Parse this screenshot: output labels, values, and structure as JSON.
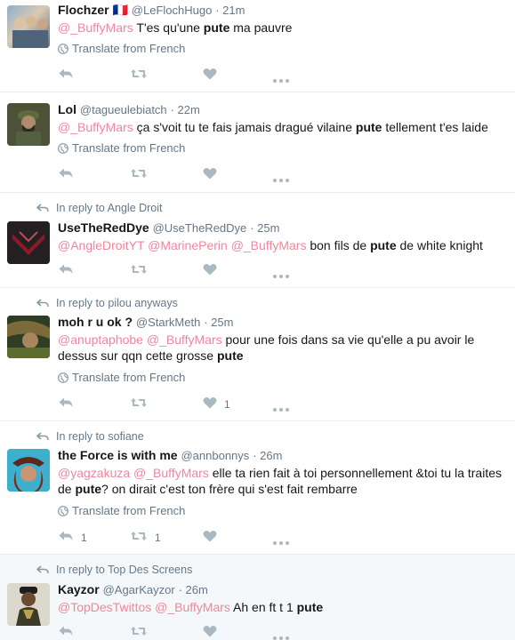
{
  "ui": {
    "translate_label": "Translate from French"
  },
  "tweets": [
    {
      "name": "Flochzer",
      "flag": "🇫🇷",
      "handle": "@LeFlochHugo",
      "time": "· 21m",
      "text": [
        {
          "t": "@_BuffyMars",
          "s": "mention"
        },
        {
          "t": " T'es qu'une ",
          "s": "plain"
        },
        {
          "t": "pute",
          "s": "kw"
        },
        {
          "t": " ma pauvre",
          "s": "plain"
        }
      ],
      "translate": true,
      "reply_count": "",
      "retweet_count": "",
      "like_count": ""
    },
    {
      "name": "Lol",
      "handle": "@tagueulebiatch",
      "time": "· 22m",
      "text": [
        {
          "t": "@_BuffyMars",
          "s": "mention"
        },
        {
          "t": " ça s'voit tu te fais jamais dragué vilaine ",
          "s": "plain"
        },
        {
          "t": "pute",
          "s": "kw"
        },
        {
          "t": " tellement t'es laide",
          "s": "plain"
        }
      ],
      "translate": true,
      "reply_count": "",
      "retweet_count": "",
      "like_count": ""
    },
    {
      "reply_to": "In reply to Angle Droit",
      "name": "UseTheRedDye",
      "handle": "@UseTheRedDye",
      "time": "· 25m",
      "text": [
        {
          "t": "@AngleDroitYT",
          "s": "mention"
        },
        {
          "t": " ",
          "s": "plain"
        },
        {
          "t": "@MarinePerin",
          "s": "mention"
        },
        {
          "t": " ",
          "s": "plain"
        },
        {
          "t": "@_BuffyMars",
          "s": "mention"
        },
        {
          "t": " bon fils de ",
          "s": "plain"
        },
        {
          "t": "pute",
          "s": "kw"
        },
        {
          "t": " de white knight",
          "s": "plain"
        }
      ],
      "translate": false,
      "reply_count": "",
      "retweet_count": "",
      "like_count": ""
    },
    {
      "reply_to": "In reply to pilou anyways",
      "name": "moh r u ok ?",
      "handle": "@StarkMeth",
      "time": "· 25m",
      "text": [
        {
          "t": "@anuptaphobe",
          "s": "mention"
        },
        {
          "t": " ",
          "s": "plain"
        },
        {
          "t": "@_BuffyMars",
          "s": "mention"
        },
        {
          "t": " pour une fois dans sa vie qu'elle a pu avoir le dessus sur qqn cette grosse ",
          "s": "plain"
        },
        {
          "t": "pute",
          "s": "kw"
        }
      ],
      "translate": true,
      "reply_count": "",
      "retweet_count": "",
      "like_count": "1"
    },
    {
      "reply_to": "In reply to sofiane",
      "name": "the Force is with me",
      "handle": "@annbonnys",
      "time": "· 26m",
      "text": [
        {
          "t": "@yagzakuza",
          "s": "mention"
        },
        {
          "t": " ",
          "s": "plain"
        },
        {
          "t": "@_BuffyMars",
          "s": "mention"
        },
        {
          "t": " elle ta rien fait à toi personnellement &toi tu la traites de ",
          "s": "plain"
        },
        {
          "t": "pute",
          "s": "kw"
        },
        {
          "t": "? on dirait c'est ton frère qui s'est fait rembarre",
          "s": "plain"
        }
      ],
      "translate": true,
      "reply_count": "1",
      "retweet_count": "1",
      "like_count": ""
    },
    {
      "reply_to": "In reply to Top Des Screens",
      "name": "Kayzor",
      "handle": "@AgarKayzor",
      "time": "· 26m",
      "text": [
        {
          "t": "@TopDesTwittos",
          "s": "mention"
        },
        {
          "t": " ",
          "s": "plain"
        },
        {
          "t": "@_BuffyMars",
          "s": "mention"
        },
        {
          "t": " Ah en ft t 1 ",
          "s": "plain"
        },
        {
          "t": "pute",
          "s": "kw"
        }
      ],
      "translate": false,
      "reply_count": "",
      "retweet_count": "",
      "like_count": ""
    }
  ]
}
